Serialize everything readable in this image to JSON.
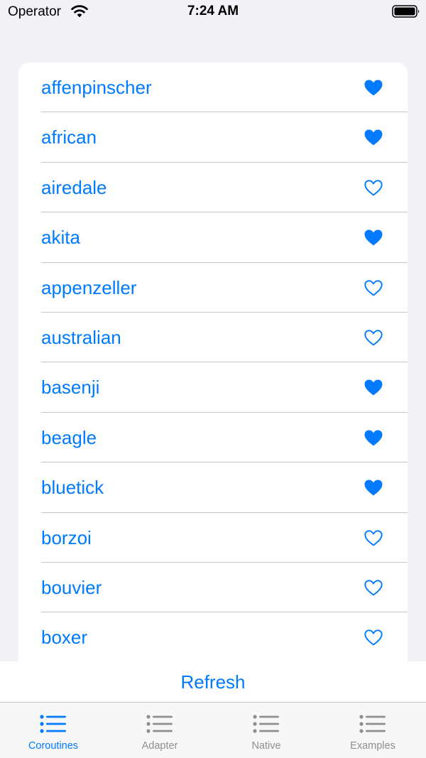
{
  "status_bar": {
    "carrier": "Operator",
    "time": "7:24 AM"
  },
  "colors": {
    "accent": "#007aff",
    "inactive": "#8e8e93",
    "background": "#f2f2f7"
  },
  "list": {
    "items": [
      {
        "label": "affenpinscher",
        "favorite": true
      },
      {
        "label": "african",
        "favorite": true
      },
      {
        "label": "airedale",
        "favorite": false
      },
      {
        "label": "akita",
        "favorite": true
      },
      {
        "label": "appenzeller",
        "favorite": false
      },
      {
        "label": "australian",
        "favorite": false
      },
      {
        "label": "basenji",
        "favorite": true
      },
      {
        "label": "beagle",
        "favorite": true
      },
      {
        "label": "bluetick",
        "favorite": true
      },
      {
        "label": "borzoi",
        "favorite": false
      },
      {
        "label": "bouvier",
        "favorite": false
      },
      {
        "label": "boxer",
        "favorite": false
      }
    ]
  },
  "refresh": {
    "label": "Refresh"
  },
  "tab_bar": {
    "tabs": [
      {
        "label": "Coroutines",
        "icon": "list-icon",
        "active": true
      },
      {
        "label": "Adapter",
        "icon": "list-icon",
        "active": false
      },
      {
        "label": "Native",
        "icon": "list-icon",
        "active": false
      },
      {
        "label": "Examples",
        "icon": "list-icon",
        "active": false
      }
    ]
  }
}
